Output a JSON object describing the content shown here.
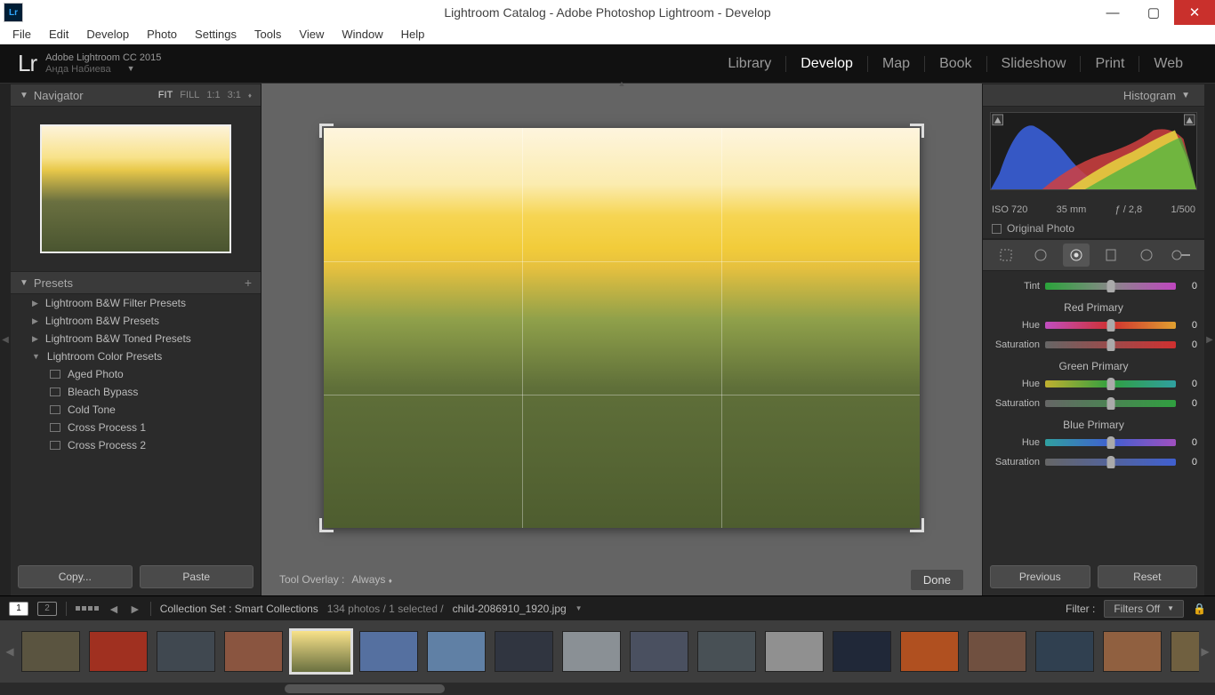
{
  "titlebar": {
    "title": "Lightroom Catalog - Adobe Photoshop Lightroom - Develop",
    "lr": "Lr"
  },
  "menubar": [
    "File",
    "Edit",
    "Develop",
    "Photo",
    "Settings",
    "Tools",
    "View",
    "Window",
    "Help"
  ],
  "identity": {
    "app": "Adobe Lightroom CC 2015",
    "user": "Анда Набиева"
  },
  "modules": [
    "Library",
    "Develop",
    "Map",
    "Book",
    "Slideshow",
    "Print",
    "Web"
  ],
  "active_module": "Develop",
  "leftpanel": {
    "navigator": {
      "label": "Navigator",
      "zoom": [
        "FIT",
        "FILL",
        "1:1",
        "3:1"
      ]
    },
    "presets": {
      "label": "Presets",
      "folders": [
        {
          "name": "Lightroom B&W Filter Presets",
          "open": false
        },
        {
          "name": "Lightroom B&W Presets",
          "open": false
        },
        {
          "name": "Lightroom B&W Toned Presets",
          "open": false
        },
        {
          "name": "Lightroom Color Presets",
          "open": true,
          "items": [
            "Aged Photo",
            "Bleach Bypass",
            "Cold Tone",
            "Cross Process 1",
            "Cross Process 2"
          ]
        }
      ]
    },
    "copy": "Copy...",
    "paste": "Paste"
  },
  "center": {
    "tool_overlay_label": "Tool Overlay :",
    "tool_overlay_value": "Always",
    "done": "Done"
  },
  "rightpanel": {
    "histogram_label": "Histogram",
    "exif": {
      "iso": "ISO 720",
      "focal": "35 mm",
      "aperture": "ƒ / 2,8",
      "shutter": "1/500"
    },
    "original_photo": "Original Photo",
    "sections": {
      "tint": {
        "label": "Tint",
        "value": "0"
      },
      "red": {
        "title": "Red Primary",
        "hue": {
          "label": "Hue",
          "value": "0"
        },
        "sat": {
          "label": "Saturation",
          "value": "0"
        }
      },
      "green": {
        "title": "Green Primary",
        "hue": {
          "label": "Hue",
          "value": "0"
        },
        "sat": {
          "label": "Saturation",
          "value": "0"
        }
      },
      "blue": {
        "title": "Blue Primary",
        "hue": {
          "label": "Hue",
          "value": "0"
        },
        "sat": {
          "label": "Saturation",
          "value": "0"
        }
      }
    },
    "previous": "Previous",
    "reset": "Reset"
  },
  "filmbar": {
    "collection": "Collection Set : Smart Collections",
    "count": "134 photos / 1 selected /",
    "filename": "child-2086910_1920.jpg",
    "filter_label": "Filter :",
    "filter_value": "Filters Off",
    "screens": [
      "1",
      "2"
    ]
  },
  "thumbs": [
    {
      "bg": "#5a5440"
    },
    {
      "bg": "#a03020"
    },
    {
      "bg": "#404850"
    },
    {
      "bg": "#8a5540"
    },
    {
      "bg": "linear-gradient(to bottom,#f8e28a,#6a7040)",
      "selected": true
    },
    {
      "bg": "#5570a0"
    },
    {
      "bg": "#6080a5"
    },
    {
      "bg": "#303540"
    },
    {
      "bg": "#8a9095"
    },
    {
      "bg": "#4a5060"
    },
    {
      "bg": "#485055"
    },
    {
      "bg": "#909090"
    },
    {
      "bg": "#202838"
    },
    {
      "bg": "#b05020"
    },
    {
      "bg": "#705040"
    },
    {
      "bg": "#304050"
    },
    {
      "bg": "#906040"
    },
    {
      "bg": "#706040"
    }
  ]
}
